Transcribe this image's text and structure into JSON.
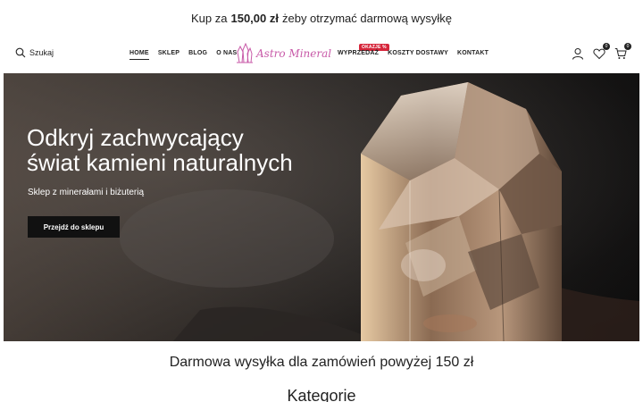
{
  "topbar": {
    "before": "Kup za",
    "amount": "150,00 zł",
    "after": "żeby otrzymać darmową wysyłkę"
  },
  "header": {
    "search_label": "Szukaj",
    "nav_left": [
      "HOME",
      "SKLEP",
      "BLOG",
      "O NAS"
    ],
    "nav_right": [
      "WYPRZEDAŻ",
      "KOSZTY DOSTAWY",
      "KONTAKT"
    ],
    "sale_badge": "OKAZJE %",
    "logo_text": "Astro Mineral",
    "wishlist_count": "0",
    "cart_count": "0"
  },
  "hero": {
    "title_line1": "Odkryj zachwycający",
    "title_line2": "świat kamieni naturalnych",
    "subtitle": "Sklep z minerałami i biżuterią",
    "button_label": "Przejdź do sklepu"
  },
  "main": {
    "shipping_text": "Darmowa wysyłka dla zamówień powyżej 150 zł",
    "categories_heading": "Kategorie"
  },
  "colors": {
    "accent": "#c85aa8",
    "badge": "#d6253a",
    "dark": "#111111"
  }
}
